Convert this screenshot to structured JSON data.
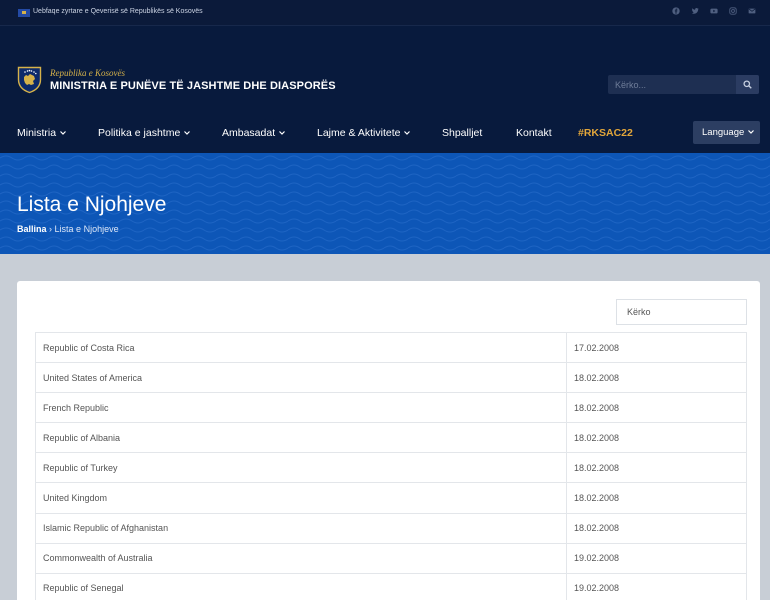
{
  "topbar": {
    "official_text": "Uebfaqe zyrtare e Qeverisë së Republikës së Kosovës",
    "social_icons": [
      "facebook-icon",
      "twitter-icon",
      "youtube-icon",
      "instagram-icon",
      "email-icon"
    ]
  },
  "header": {
    "gov_name": "Republika e Kosovës",
    "ministry_name": "MINISTRIA E PUNËVE TË JASHTME DHE DIASPORËS",
    "search_placeholder": "Kërko..."
  },
  "nav": {
    "items": [
      {
        "label": "Ministria",
        "dropdown": true
      },
      {
        "label": "Politika e jashtme",
        "dropdown": true
      },
      {
        "label": "Ambasadat",
        "dropdown": true
      },
      {
        "label": "Lajme & Aktivitete",
        "dropdown": true
      },
      {
        "label": "Shpalljet",
        "dropdown": false
      },
      {
        "label": "Kontakt",
        "dropdown": false
      },
      {
        "label": "#RKSAC22",
        "dropdown": false
      }
    ],
    "language_label": "Language"
  },
  "banner": {
    "title": "Lista e Njohjeve",
    "breadcrumb_home": "Ballina",
    "breadcrumb_separator": "›",
    "breadcrumb_current": "Lista e Njohjeve"
  },
  "table": {
    "search_placeholder": "Kërko",
    "rows": [
      {
        "country": "Republic of Costa Rica",
        "date": "17.02.2008"
      },
      {
        "country": "United States of America",
        "date": "18.02.2008"
      },
      {
        "country": "French Republic",
        "date": "18.02.2008"
      },
      {
        "country": "Republic of Albania",
        "date": "18.02.2008"
      },
      {
        "country": "Republic of Turkey",
        "date": "18.02.2008"
      },
      {
        "country": "United Kingdom",
        "date": "18.02.2008"
      },
      {
        "country": "Islamic Republic of Afghanistan",
        "date": "18.02.2008"
      },
      {
        "country": "Commonwealth of Australia",
        "date": "19.02.2008"
      },
      {
        "country": "Republic of Senegal",
        "date": "19.02.2008"
      }
    ]
  },
  "colors": {
    "header_bg": "#081a3d",
    "banner_bg": "#0d56b7",
    "accent_gold": "#e2a63a",
    "page_bg": "#c8ced6"
  }
}
